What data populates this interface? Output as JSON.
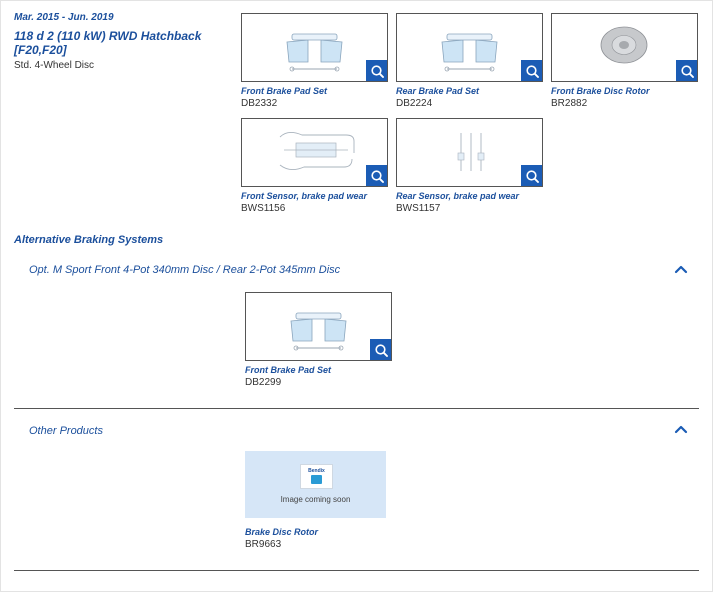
{
  "vehicle": {
    "date_range": "Mar. 2015 - Jun. 2019",
    "model_line1": "118 d 2 (110 kW) RWD Hatchback",
    "model_line2": "[F20,F20]",
    "subtitle": "Std. 4-Wheel Disc"
  },
  "products": [
    {
      "name": "Front Brake Pad Set",
      "code": "DB2332",
      "image": "brake-pad-set"
    },
    {
      "name": "Rear Brake Pad Set",
      "code": "DB2224",
      "image": "brake-pad-set"
    },
    {
      "name": "Front Brake Disc Rotor",
      "code": "BR2882",
      "image": "brake-disc-rotor"
    },
    {
      "name": "Front Sensor, brake pad wear",
      "code": "BWS1156",
      "image": "wear-sensor"
    },
    {
      "name": "Rear Sensor, brake pad wear",
      "code": "BWS1157",
      "image": "wear-sensor"
    }
  ],
  "alternative": {
    "title": "Alternative Braking Systems",
    "section_title": "Opt. M Sport Front 4-Pot 340mm Disc / Rear 2-Pot 345mm Disc",
    "products": [
      {
        "name": "Front Brake Pad Set",
        "code": "DB2299",
        "image": "brake-pad-set"
      }
    ]
  },
  "other": {
    "section_title": "Other Products",
    "products": [
      {
        "name": "Brake Disc Rotor",
        "code": "BR9663",
        "image_placeholder": "Image coming soon",
        "logo_text": "Bendix"
      }
    ]
  },
  "icons": {
    "zoom": "magnifier-icon",
    "collapse": "chevron-up-icon"
  },
  "colors": {
    "brand_blue": "#1b4f9c",
    "button_blue": "#1b5cb5",
    "placeholder_bg": "#d6e6f7",
    "pad_blue": "#cde4f5"
  }
}
